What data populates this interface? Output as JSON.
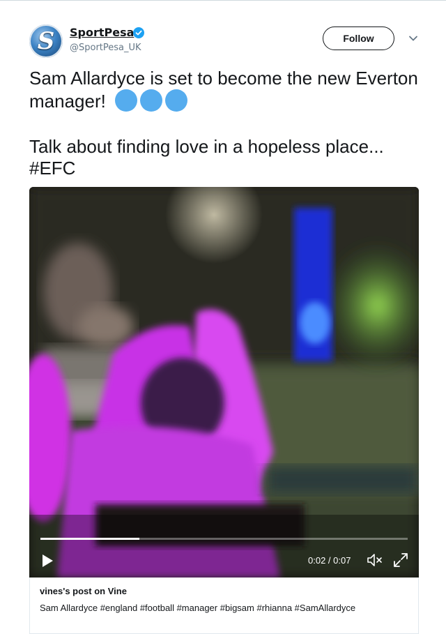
{
  "tweet": {
    "author": {
      "avatar_letter": "S",
      "name": "SportPesa",
      "handle": "@SportPesa_UK",
      "verified": true
    },
    "follow_label": "Follow",
    "text_line1": "Sam Allardyce is set to become the new Everton manager!",
    "text_line2": "Talk about finding love in a hopeless place...",
    "hashtag": "#EFC",
    "emoji_color": "#55acee"
  },
  "media": {
    "current_time": "0:02",
    "separator": " / ",
    "duration": "0:07",
    "progress": 0.27,
    "footer_title": "vines's post on Vine",
    "footer_description": "Sam Allardyce #england #football #manager #bigsam #rhianna #SamAllardyce"
  },
  "colors": {
    "accent": "#1da1f2",
    "text": "#14171a",
    "muted": "#657786"
  }
}
